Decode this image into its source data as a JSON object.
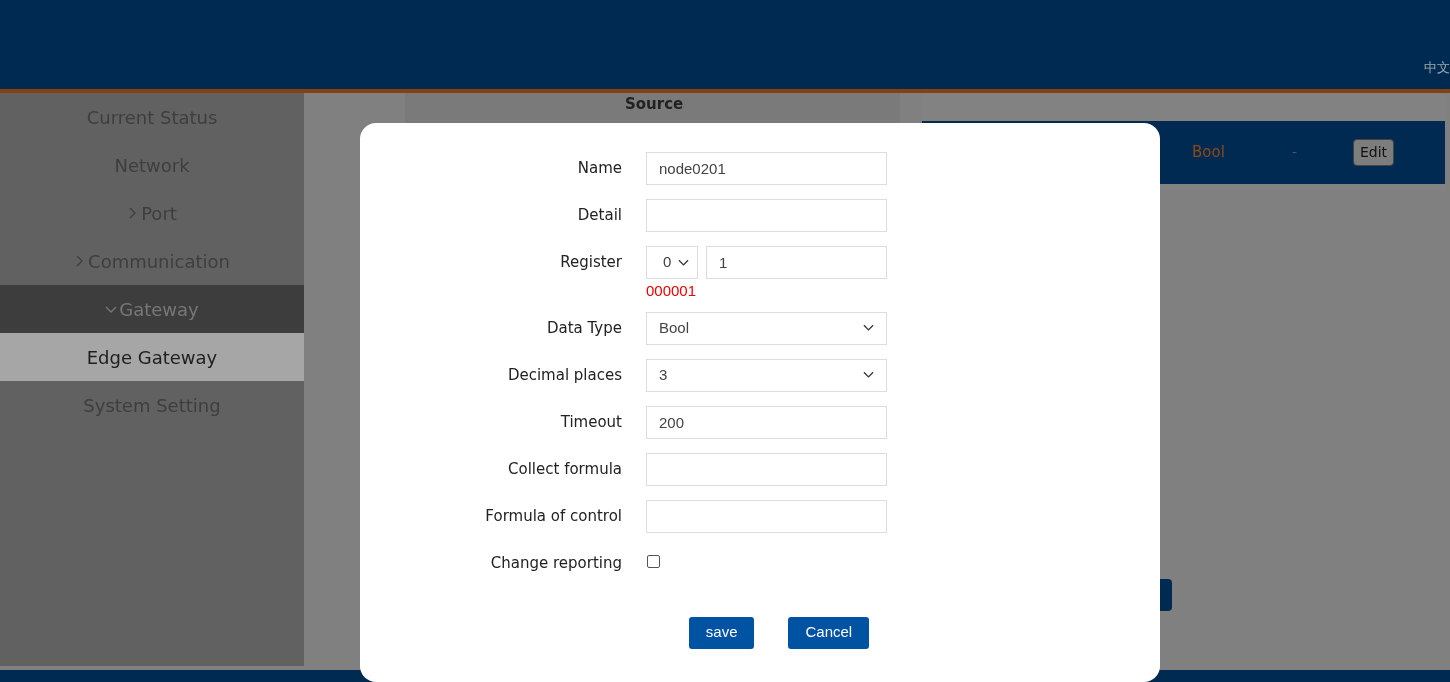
{
  "header": {
    "language": "中文"
  },
  "sidebar": {
    "items": [
      {
        "label": "Current Status",
        "kind": "link",
        "selected": false
      },
      {
        "label": "Network",
        "kind": "link",
        "selected": false
      },
      {
        "label": "Port",
        "kind": "group",
        "expanded": false,
        "selected": false
      },
      {
        "label": "Communication",
        "kind": "group",
        "expanded": false,
        "selected": false
      },
      {
        "label": "Gateway",
        "kind": "group",
        "expanded": true,
        "selected": false,
        "children": [
          {
            "label": "Edge Gateway",
            "selected": true
          }
        ]
      },
      {
        "label": "System Setting",
        "kind": "link",
        "selected": false
      }
    ]
  },
  "source_table": {
    "heading": "Source"
  },
  "points_table": {
    "rows": [
      {
        "data_type": "Bool",
        "value": "-",
        "action": "Edit"
      }
    ]
  },
  "dialog": {
    "fields": [
      {
        "kind": "text",
        "label": "Name",
        "value": "node0201"
      },
      {
        "kind": "text",
        "label": "Detail"
      },
      {
        "kind": "register",
        "label": "Register",
        "area": "0",
        "value": "1",
        "address": "000001"
      },
      {
        "kind": "select",
        "label": "Data Type",
        "value": "Bool"
      },
      {
        "kind": "select",
        "label": "Decimal places",
        "value": "3"
      },
      {
        "kind": "text",
        "label": "Timeout",
        "value": "200"
      },
      {
        "kind": "text",
        "label": "Collect formula"
      },
      {
        "kind": "text",
        "label": "Formula of control"
      },
      {
        "kind": "checkbox",
        "label": "Change reporting",
        "checked": false
      }
    ],
    "buttons": [
      "save",
      "Cancel"
    ]
  }
}
